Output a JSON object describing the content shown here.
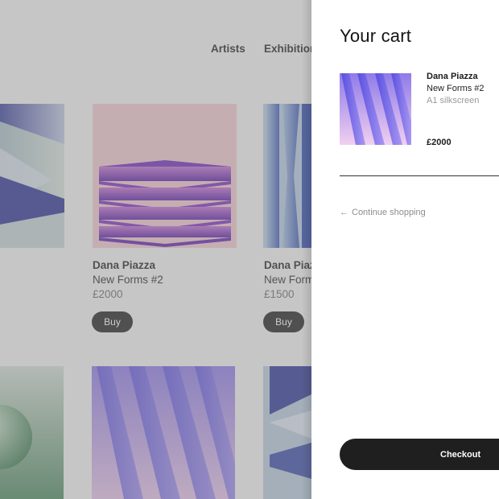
{
  "nav": {
    "items": [
      {
        "label": "Artists"
      },
      {
        "label": "Exhibition"
      }
    ]
  },
  "grid": {
    "cards": [
      {
        "artist": "Dana Piazza",
        "title": "New Forms #2",
        "price": "£2000",
        "buy_label": "Buy"
      },
      {
        "artist": "Dana Piazza",
        "title": "New Forms",
        "price": "£1500",
        "buy_label": "Buy"
      }
    ]
  },
  "cart": {
    "title": "Your cart",
    "item": {
      "artist": "Dana Piazza",
      "title": "New Forms #2",
      "medium": "A1 silkscreen",
      "price": "£2000"
    },
    "continue_label": "Continue shopping",
    "checkout_label": "Checkout"
  },
  "colors": {
    "overlay": "#8c8c8c",
    "button": "#1f1f1f",
    "pink_art_bg": "#f3c9cf",
    "purple": "#6d2bc4",
    "violet": "#6a5fe6",
    "navy": "#2f3aa0",
    "sage": "#cfdcd2",
    "green": "#2f7a4c",
    "steel_blue": "#7fa7d6"
  },
  "icons": [
    "arrow-left-icon"
  ]
}
